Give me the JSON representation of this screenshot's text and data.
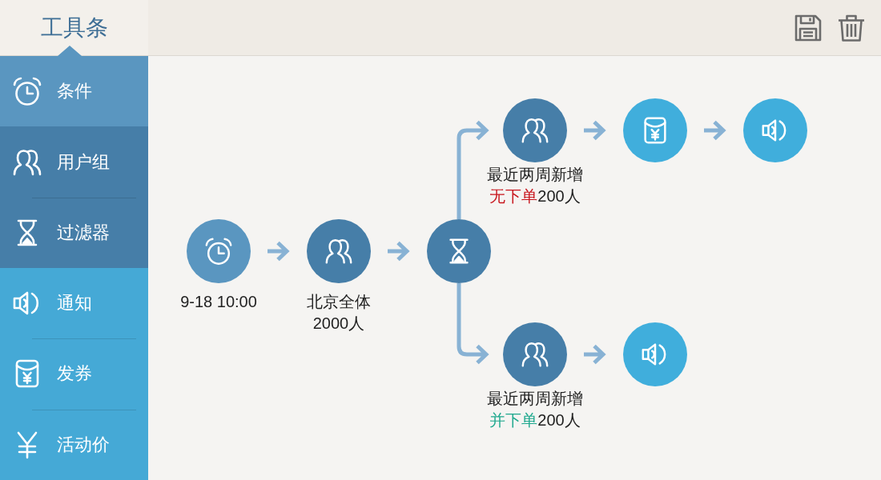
{
  "toolbar": {
    "title": "工具条"
  },
  "sidebar": {
    "groups": [
      {
        "color": "#5a96c0",
        "items": [
          {
            "label": "条件",
            "kind": "clock"
          }
        ]
      },
      {
        "color": "#467ea8",
        "items": [
          {
            "label": "用户组",
            "kind": "users"
          },
          {
            "label": "过滤器",
            "kind": "hourglass"
          }
        ]
      },
      {
        "color": "#45a9d6",
        "items": [
          {
            "label": "通知",
            "kind": "speaker"
          },
          {
            "label": "发券",
            "kind": "coupon"
          },
          {
            "label": "活动价",
            "kind": "yen"
          }
        ]
      }
    ]
  },
  "flow": {
    "steps": [
      {
        "kind": "clock",
        "color": "#5a96c0",
        "label": [
          [
            {
              "text": "9-18 10:00"
            }
          ]
        ]
      },
      {
        "kind": "users",
        "color": "#467ea8",
        "label": [
          [
            {
              "text": "北京全体"
            }
          ],
          [
            {
              "text": "2000人"
            }
          ]
        ]
      },
      {
        "kind": "hourglass",
        "color": "#467ea8"
      }
    ],
    "branches": [
      {
        "steps": [
          {
            "kind": "users",
            "color": "#467ea8",
            "label": [
              [
                {
                  "text": "最近两周新增"
                }
              ],
              [
                {
                  "text": "无下单",
                  "color": "#c8161e"
                },
                {
                  "text": "200人"
                }
              ]
            ]
          },
          {
            "kind": "coupon",
            "color": "#40aedc"
          },
          {
            "kind": "speaker",
            "color": "#40aedc"
          }
        ]
      },
      {
        "steps": [
          {
            "kind": "users",
            "color": "#467ea8",
            "label": [
              [
                {
                  "text": "最近两周新增"
                }
              ],
              [
                {
                  "text": "并下单",
                  "color": "#1fa88e"
                },
                {
                  "text": "200人"
                }
              ]
            ]
          },
          {
            "kind": "speaker",
            "color": "#40aedc"
          }
        ]
      }
    ]
  }
}
